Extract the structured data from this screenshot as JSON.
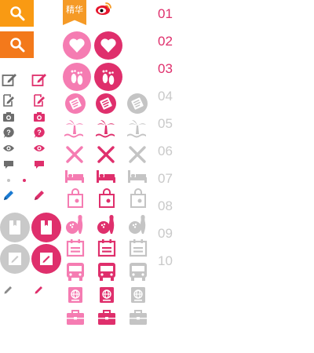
{
  "colors": {
    "orange": "#f99a13",
    "orange_dark": "#f3791b",
    "pink": "#df2f6c",
    "pink_light": "#f57cb2",
    "gray": "#bdbdbd",
    "dark_gray": "#6d6d6d",
    "blue": "#1a7ad1"
  },
  "ribbon": {
    "label": "精华"
  },
  "rank_numbers": [
    "01",
    "02",
    "03",
    "04",
    "05",
    "06",
    "07",
    "08",
    "09",
    "10"
  ],
  "icons": {
    "row_names": [
      "heart",
      "footprint",
      "document",
      "island",
      "food",
      "bed",
      "shopping-bag",
      "bowling",
      "calendar",
      "bus",
      "passport",
      "briefcase"
    ],
    "left_column": [
      "edit",
      "write",
      "camera",
      "question",
      "eye",
      "comment",
      "dot",
      "pencil",
      "bookmark-book",
      "edit-note",
      "small-pencil"
    ]
  }
}
